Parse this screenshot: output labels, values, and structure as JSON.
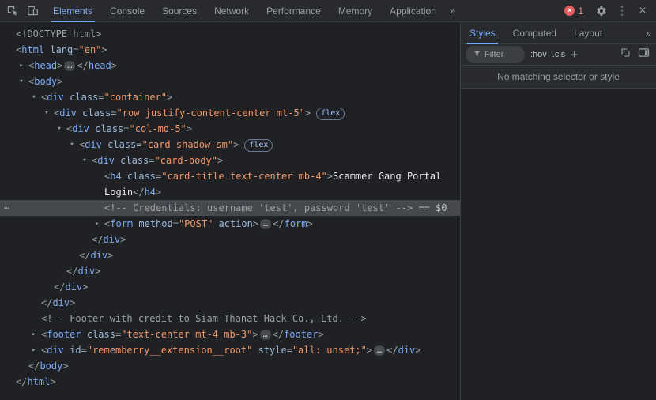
{
  "toolbar": {
    "tabs": [
      {
        "label": "Elements",
        "selected": true
      },
      {
        "label": "Console",
        "selected": false
      },
      {
        "label": "Sources",
        "selected": false
      },
      {
        "label": "Network",
        "selected": false
      },
      {
        "label": "Performance",
        "selected": false
      },
      {
        "label": "Memory",
        "selected": false
      },
      {
        "label": "Application",
        "selected": false
      }
    ],
    "more_tabs": "»",
    "error_icon_glyph": "×",
    "error_count": "1",
    "more_options_glyph": "⋮",
    "close_glyph": "×"
  },
  "styles_panel": {
    "tabs": [
      {
        "label": "Styles",
        "selected": true
      },
      {
        "label": "Computed",
        "selected": false
      },
      {
        "label": "Layout",
        "selected": false
      }
    ],
    "more_tabs": "»",
    "filter_placeholder": "Filter",
    "hov_button": ":hov",
    "cls_button": ".cls",
    "new_rule_button": "+",
    "empty_message": "No matching selector or style"
  },
  "tree": {
    "gutter_more": "⋯",
    "lines": [
      {
        "name": "doctype",
        "indent": 0,
        "tokens": [
          [
            "gray",
            "<!DOCTYPE html>"
          ]
        ]
      },
      {
        "name": "html-open",
        "indent": 0,
        "tokens": [
          [
            "punct",
            "<"
          ],
          [
            "tag",
            "html"
          ],
          [
            "attr",
            " lang"
          ],
          [
            "punct",
            "="
          ],
          [
            "value",
            "\"en\""
          ],
          [
            "punct",
            ">"
          ]
        ]
      },
      {
        "name": "head",
        "indent": 1,
        "arrow": "collapsed",
        "tokens": [
          [
            "punct",
            "<"
          ],
          [
            "tag",
            "head"
          ],
          [
            "punct",
            ">"
          ],
          [
            "ellipsis",
            "…"
          ],
          [
            "punct",
            "</"
          ],
          [
            "tag",
            "head"
          ],
          [
            "punct",
            ">"
          ]
        ]
      },
      {
        "name": "body-open",
        "indent": 1,
        "arrow": "expanded",
        "tokens": [
          [
            "punct",
            "<"
          ],
          [
            "tag",
            "body"
          ],
          [
            "punct",
            ">"
          ]
        ]
      },
      {
        "name": "div-container-open",
        "indent": 2,
        "arrow": "expanded",
        "tokens": [
          [
            "punct",
            "<"
          ],
          [
            "tag",
            "div"
          ],
          [
            "attr",
            " class"
          ],
          [
            "punct",
            "="
          ],
          [
            "value",
            "\"container\""
          ],
          [
            "punct",
            ">"
          ]
        ]
      },
      {
        "name": "div-row-open",
        "indent": 3,
        "arrow": "expanded",
        "tokens": [
          [
            "punct",
            "<"
          ],
          [
            "tag",
            "div"
          ],
          [
            "attr",
            " class"
          ],
          [
            "punct",
            "="
          ],
          [
            "value",
            "\"row justify-content-center mt-5\""
          ],
          [
            "punct",
            ">"
          ],
          [
            "badge",
            "flex"
          ]
        ]
      },
      {
        "name": "div-col-open",
        "indent": 4,
        "arrow": "expanded",
        "tokens": [
          [
            "punct",
            "<"
          ],
          [
            "tag",
            "div"
          ],
          [
            "attr",
            " class"
          ],
          [
            "punct",
            "="
          ],
          [
            "value",
            "\"col-md-5\""
          ],
          [
            "punct",
            ">"
          ]
        ]
      },
      {
        "name": "div-card-open",
        "indent": 5,
        "arrow": "expanded",
        "tokens": [
          [
            "punct",
            "<"
          ],
          [
            "tag",
            "div"
          ],
          [
            "attr",
            " class"
          ],
          [
            "punct",
            "="
          ],
          [
            "value",
            "\"card shadow-sm\""
          ],
          [
            "punct",
            ">"
          ],
          [
            "badge",
            "flex"
          ]
        ]
      },
      {
        "name": "div-card-body-open",
        "indent": 6,
        "arrow": "expanded",
        "tokens": [
          [
            "punct",
            "<"
          ],
          [
            "tag",
            "div"
          ],
          [
            "attr",
            " class"
          ],
          [
            "punct",
            "="
          ],
          [
            "value",
            "\"card-body\""
          ],
          [
            "punct",
            ">"
          ]
        ]
      },
      {
        "name": "h4-title",
        "indent": 7,
        "tokens": [
          [
            "punct",
            "<"
          ],
          [
            "tag",
            "h4"
          ],
          [
            "attr",
            " class"
          ],
          [
            "punct",
            "="
          ],
          [
            "value",
            "\"card-title text-center mb-4\""
          ],
          [
            "punct",
            ">"
          ],
          [
            "text",
            "Scammer Gang Portal Login"
          ],
          [
            "punct",
            "</"
          ],
          [
            "tag",
            "h4"
          ],
          [
            "punct",
            ">"
          ]
        ]
      },
      {
        "name": "credentials-comment",
        "indent": 7,
        "selected": true,
        "gutter": true,
        "tokens": [
          [
            "comment",
            "<!-- Credentials: username 'test', password 'test' -->"
          ],
          [
            "eq",
            " == $0"
          ]
        ]
      },
      {
        "name": "form",
        "indent": 7,
        "arrow": "collapsed",
        "tokens": [
          [
            "punct",
            "<"
          ],
          [
            "tag",
            "form"
          ],
          [
            "attr",
            " method"
          ],
          [
            "punct",
            "="
          ],
          [
            "value",
            "\"POST\""
          ],
          [
            "attr",
            " action"
          ],
          [
            "punct",
            ">"
          ],
          [
            "ellipsis",
            "…"
          ],
          [
            "punct",
            "</"
          ],
          [
            "tag",
            "form"
          ],
          [
            "punct",
            ">"
          ]
        ]
      },
      {
        "name": "div-card-body-close",
        "indent": 6,
        "tokens": [
          [
            "punct",
            "</"
          ],
          [
            "tag",
            "div"
          ],
          [
            "punct",
            ">"
          ]
        ]
      },
      {
        "name": "div-card-close",
        "indent": 5,
        "tokens": [
          [
            "punct",
            "</"
          ],
          [
            "tag",
            "div"
          ],
          [
            "punct",
            ">"
          ]
        ]
      },
      {
        "name": "div-col-close",
        "indent": 4,
        "tokens": [
          [
            "punct",
            "</"
          ],
          [
            "tag",
            "div"
          ],
          [
            "punct",
            ">"
          ]
        ]
      },
      {
        "name": "div-row-close",
        "indent": 3,
        "tokens": [
          [
            "punct",
            "</"
          ],
          [
            "tag",
            "div"
          ],
          [
            "punct",
            ">"
          ]
        ]
      },
      {
        "name": "div-container-close",
        "indent": 2,
        "tokens": [
          [
            "punct",
            "</"
          ],
          [
            "tag",
            "div"
          ],
          [
            "punct",
            ">"
          ]
        ]
      },
      {
        "name": "footer-comment",
        "indent": 2,
        "tokens": [
          [
            "comment",
            "<!-- Footer with credit to Siam Thanat Hack Co., Ltd. -->"
          ]
        ]
      },
      {
        "name": "footer",
        "indent": 2,
        "arrow": "collapsed",
        "tokens": [
          [
            "punct",
            "<"
          ],
          [
            "tag",
            "footer"
          ],
          [
            "attr",
            " class"
          ],
          [
            "punct",
            "="
          ],
          [
            "value",
            "\"text-center mt-4 mb-3\""
          ],
          [
            "punct",
            ">"
          ],
          [
            "ellipsis",
            "…"
          ],
          [
            "punct",
            "</"
          ],
          [
            "tag",
            "footer"
          ],
          [
            "punct",
            ">"
          ]
        ]
      },
      {
        "name": "rememberry-div",
        "indent": 2,
        "arrow": "collapsed",
        "tokens": [
          [
            "punct",
            "<"
          ],
          [
            "tag",
            "div"
          ],
          [
            "attr",
            " id"
          ],
          [
            "punct",
            "="
          ],
          [
            "value",
            "\"rememberry__extension__root\""
          ],
          [
            "attr",
            " style"
          ],
          [
            "punct",
            "="
          ],
          [
            "value",
            "\"all: unset;\""
          ],
          [
            "punct",
            ">"
          ],
          [
            "ellipsis",
            "…"
          ],
          [
            "punct",
            "</"
          ],
          [
            "tag",
            "div"
          ],
          [
            "punct",
            ">"
          ]
        ]
      },
      {
        "name": "body-close",
        "indent": 1,
        "tokens": [
          [
            "punct",
            "</"
          ],
          [
            "tag",
            "body"
          ],
          [
            "punct",
            ">"
          ]
        ]
      },
      {
        "name": "html-close",
        "indent": 0,
        "tokens": [
          [
            "punct",
            "</"
          ],
          [
            "tag",
            "html"
          ],
          [
            "punct",
            ">"
          ]
        ]
      }
    ]
  },
  "colors": {
    "background": "#202124",
    "toolbar": "#292a2d",
    "border": "#3c4043",
    "accent": "#7cacf8",
    "tag": "#7cacf8",
    "attribute": "#9bbbdc",
    "value": "#f29766",
    "comment": "#9aa0a6",
    "error": "#f28b82",
    "selection": "#45484c"
  }
}
